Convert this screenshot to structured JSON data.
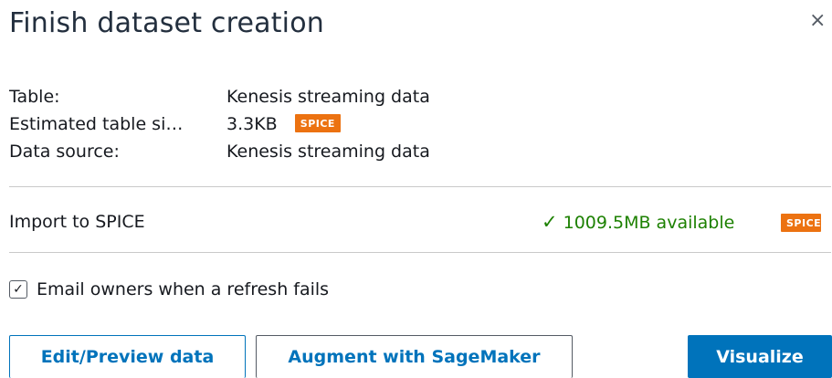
{
  "dialog": {
    "title": "Finish dataset creation",
    "close_symbol": "×"
  },
  "info": {
    "table_label": "Table:",
    "table_value": "Kenesis streaming data",
    "size_label": "Estimated table si…",
    "size_value": "3.3KB",
    "size_badge": "SPICE",
    "source_label": "Data source:",
    "source_value": "Kenesis streaming data"
  },
  "spice": {
    "label": "Import to SPICE",
    "check_symbol": "✓",
    "available_text": "1009.5MB available",
    "badge": "SPICE"
  },
  "email": {
    "checked": true,
    "check_symbol": "✓",
    "label": "Email owners when a refresh fails"
  },
  "buttons": {
    "edit_preview": "Edit/Preview data",
    "augment": "Augment with SageMaker",
    "visualize": "Visualize"
  },
  "colors": {
    "accent": "#0073bb",
    "spice_badge": "#ec7211",
    "success": "#1d8102"
  },
  "icons": {
    "close": "close-icon",
    "check": "check-icon",
    "checkbox": "checkbox-checked-icon"
  }
}
